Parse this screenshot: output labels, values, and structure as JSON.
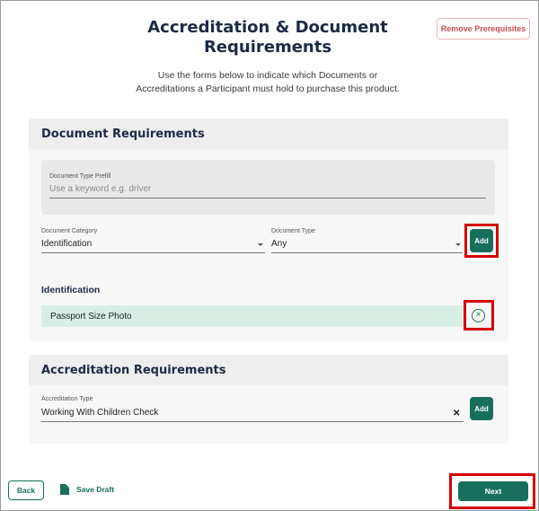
{
  "page": {
    "title_line1": "Accreditation & Document",
    "title_line2": "Requirements",
    "remove_prerequisites_label": "Remove Prerequisites",
    "subtitle_line1": "Use the forms below to indicate which Documents or",
    "subtitle_line2": "Accreditations a Participant must hold to purchase this product."
  },
  "document_requirements": {
    "header": "Document Requirements",
    "prefill": {
      "label": "Document Type Prefill",
      "placeholder": "Use a keyword e.g. driver"
    },
    "category": {
      "label": "Document Category",
      "value": "Identification"
    },
    "type": {
      "label": "Document Type",
      "value": "Any"
    },
    "add_label": "Add",
    "group_label": "Identification",
    "items": [
      {
        "name": "Passport Size Photo"
      }
    ],
    "remove_icon": "circle-x-icon"
  },
  "accreditation_requirements": {
    "header": "Accreditation Requirements",
    "type": {
      "label": "Accreditation Type",
      "value": "Working With Children Check"
    },
    "clear_icon": "close-icon",
    "add_label": "Add"
  },
  "footer": {
    "back_label": "Back",
    "save_draft_label": "Save Draft",
    "next_label": "Next"
  },
  "colors": {
    "primary": "#18705c",
    "danger": "#d24d4d",
    "highlight": "#d50000",
    "item_bg": "#d9efe6"
  }
}
